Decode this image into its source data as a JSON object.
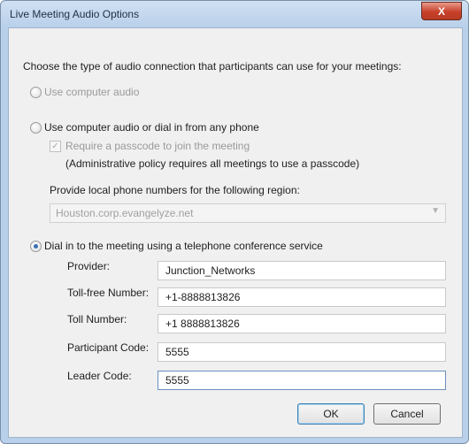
{
  "window": {
    "title": "Live Meeting Audio Options",
    "close_glyph": "X"
  },
  "intro": "Choose the type of audio connection that participants can use for your meetings:",
  "options": {
    "computer_audio": "Use computer audio",
    "computer_or_phone": "Use computer audio or dial in from any phone",
    "dial_in_service": "Dial in to the meeting using a telephone conference service"
  },
  "passcode": {
    "checkbox_label": "Require a passcode to join the meeting",
    "checked": true,
    "policy_note": "(Administrative policy requires all meetings to use a passcode)"
  },
  "region": {
    "label": "Provide local phone numbers for the following region:",
    "value": "Houston.corp.evangelyze.net"
  },
  "fields": {
    "provider": {
      "label": "Provider:",
      "value": "Junction_Networks"
    },
    "toll_free": {
      "label": "Toll-free Number:",
      "value": "+1-8888813826"
    },
    "toll": {
      "label": "Toll Number:",
      "value": "+1 8888813826"
    },
    "participant_code": {
      "label": "Participant Code:",
      "value": "5555"
    },
    "leader_code": {
      "label": "Leader Code:",
      "value": "5555"
    }
  },
  "buttons": {
    "ok": "OK",
    "cancel": "Cancel"
  },
  "selected_option": "dial_in_service"
}
